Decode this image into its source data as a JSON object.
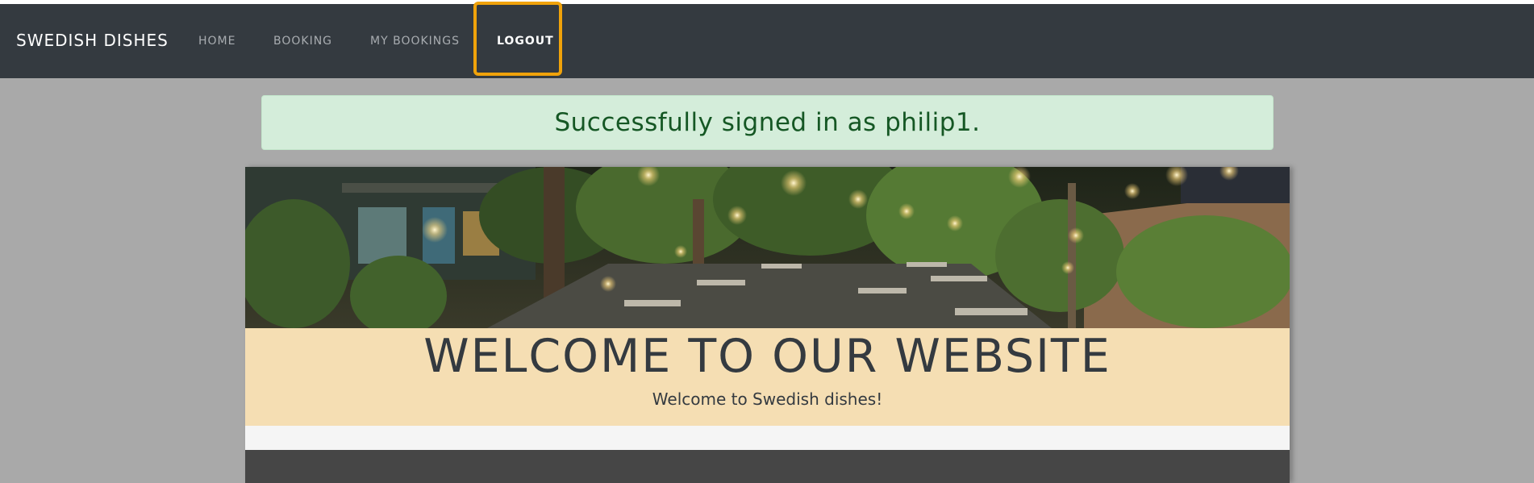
{
  "navbar": {
    "brand": "SWEDISH DISHES",
    "items": [
      {
        "label": "HOME"
      },
      {
        "label": "BOOKING"
      },
      {
        "label": "MY BOOKINGS"
      },
      {
        "label": "LOGOUT"
      }
    ]
  },
  "alert": {
    "message": "Successfully signed in as philip1."
  },
  "welcome": {
    "heading": "WELCOME TO OUR WEBSITE",
    "subtitle": "Welcome to Swedish dishes!"
  },
  "colors": {
    "navbar_bg": "#343a40",
    "page_bg": "#a9a9a9",
    "alert_bg": "#d4edda",
    "alert_text": "#155724",
    "welcome_bg": "#f5deb3",
    "highlight": "#f0a20a"
  }
}
